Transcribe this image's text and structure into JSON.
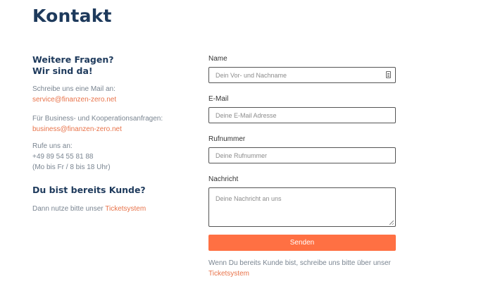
{
  "page_title": "Kontakt",
  "left": {
    "heading_line1": "Weitere Fragen?",
    "heading_line2": "Wir sind da!",
    "mail_intro": "Schreibe uns eine Mail an:",
    "mail_link": "service@finanzen-zero.net",
    "business_intro": "Für Business- und Kooperationsanfragen:",
    "business_link": "business@finanzen-zero.net",
    "call_intro": "Rufe uns an:",
    "phone": "+49 89 54 55 81 88",
    "hours": "(Mo bis Fr / 8 bis 18 Uhr)",
    "customer_heading": "Du bist bereits Kunde?",
    "customer_text": "Dann nutze bitte unser",
    "customer_link": "Ticketsystem"
  },
  "form": {
    "name_label": "Name",
    "name_placeholder": "Dein Vor- und Nachname",
    "email_label": "E-Mail",
    "email_placeholder": "Deine E-Mail Adresse",
    "phone_label": "Rufnummer",
    "phone_placeholder": "Deine Rufnummer",
    "message_label": "Nachricht",
    "message_placeholder": "Deine Nachricht an uns",
    "send_label": "Senden",
    "note_text": "Wenn Du bereits Kunde bist, schreibe uns bitte über unser",
    "note_link": "Ticketsystem"
  },
  "colors": {
    "heading": "#1e3a5c",
    "accent": "#e8734a",
    "button": "#ff7043"
  }
}
